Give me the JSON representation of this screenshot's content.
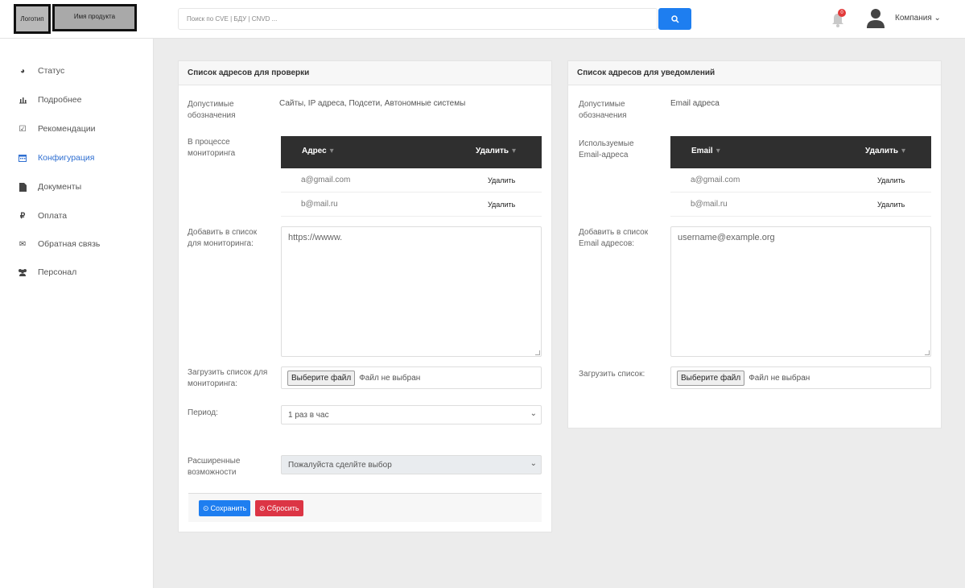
{
  "header": {
    "logo": "Логотип",
    "product": "Имя продукта",
    "search_placeholder": "Поиск по CVE | БДУ | CNVD ...",
    "notifications_count": "0",
    "company": "Компания ⌄"
  },
  "sidebar": {
    "items": [
      {
        "label": "Статус",
        "icon": "dashboard-icon"
      },
      {
        "label": "Подробнее",
        "icon": "chart-icon"
      },
      {
        "label": "Рекомендации",
        "icon": "checkbox-icon"
      },
      {
        "label": "Конфигурация",
        "icon": "calendar-icon"
      },
      {
        "label": "Документы",
        "icon": "document-icon"
      },
      {
        "label": "Оплата",
        "icon": "ruble-icon"
      },
      {
        "label": "Обратная связь",
        "icon": "envelope-icon"
      },
      {
        "label": "Персонал",
        "icon": "users-icon"
      }
    ],
    "active": "Конфигурация"
  },
  "check_card": {
    "title": "Список адресов для проверки",
    "allowed_label": "Допустимые обозначения",
    "allowed_value": "Сайты, IP адреса, Подсети, Автономные системы",
    "monitoring_label": "В процессе мониторинга",
    "table": {
      "col_address": "Адрес",
      "col_delete": "Удалить",
      "rows": [
        {
          "address": "a@gmail.com",
          "action": "Удалить"
        },
        {
          "address": "b@mail.ru",
          "action": "Удалить"
        }
      ]
    },
    "add_label": "Добавить в список для мониторинга:",
    "add_placeholder": "https://wwww.",
    "upload_label": "Загрузить список для мониторинга:",
    "file_button": "Выберите файл",
    "file_status": "Файл не выбран",
    "period_label": "Период:",
    "period_value": "1 раз в час",
    "advanced_label": "Расширенные возможности",
    "advanced_value": "Пожалуйста сделйте выбор",
    "save": "Сохранить",
    "reset": "Сбросить"
  },
  "notify_card": {
    "title": "Список адресов для уведомлений",
    "allowed_label": "Допустимые обозначения",
    "allowed_value": "Email адреса",
    "used_label": "Используемые Email-адреса",
    "table": {
      "col_email": "Email",
      "col_delete": "Удалить",
      "rows": [
        {
          "address": "a@gmail.com",
          "action": "Удалить"
        },
        {
          "address": "b@mail.ru",
          "action": "Удалить"
        }
      ]
    },
    "add_label": "Добавить в список Email адресов:",
    "add_placeholder": "username@example.org",
    "upload_label": "Загрузить список:",
    "file_button": "Выберите файл",
    "file_status": "Файл не выбран"
  },
  "colors": {
    "accent": "#1e7ef0",
    "danger": "#dc3545",
    "active_nav": "#2f6fd1",
    "table_header": "#2f2f2f"
  }
}
